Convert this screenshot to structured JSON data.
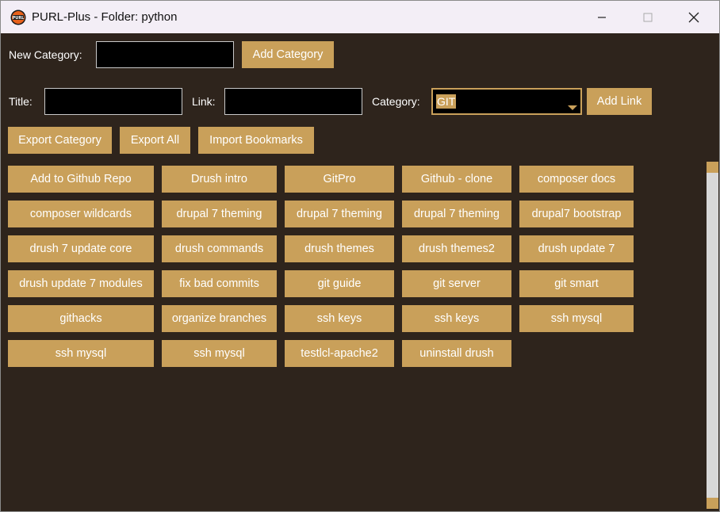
{
  "window": {
    "title": "PURL-Plus - Folder: python"
  },
  "colors": {
    "background": "#2e241c",
    "button": "#c9a05a",
    "field": "#000000",
    "titlebar": "#f3eef6"
  },
  "category_row": {
    "label": "New Category:",
    "input_value": "",
    "button_label": "Add Category"
  },
  "link_row": {
    "title_label": "Title:",
    "title_value": "",
    "link_label": "Link:",
    "link_value": "",
    "category_label": "Category:",
    "category_selected": "GIT",
    "button_label": "Add Link"
  },
  "actions": {
    "export_category": "Export Category",
    "export_all": "Export All",
    "import_bookmarks": "Import Bookmarks"
  },
  "bookmarks": [
    [
      "Add to Github Repo",
      "Drush intro",
      "GitPro",
      "Github - clone",
      "composer docs"
    ],
    [
      "composer wildcards",
      "drupal 7 theming",
      "drupal 7 theming",
      "drupal 7 theming",
      "drupal7 bootstrap"
    ],
    [
      "drush 7 update core",
      "drush commands",
      "drush themes",
      "drush themes2",
      "drush update 7"
    ],
    [
      "drush update 7 modules",
      "fix bad commits",
      "git guide",
      "git server",
      "git smart"
    ],
    [
      "githacks",
      "organize branches",
      "ssh keys",
      "ssh keys",
      "ssh mysql"
    ],
    [
      "ssh mysql",
      "ssh mysql",
      "testlcl-apache2",
      "uninstall drush"
    ]
  ]
}
